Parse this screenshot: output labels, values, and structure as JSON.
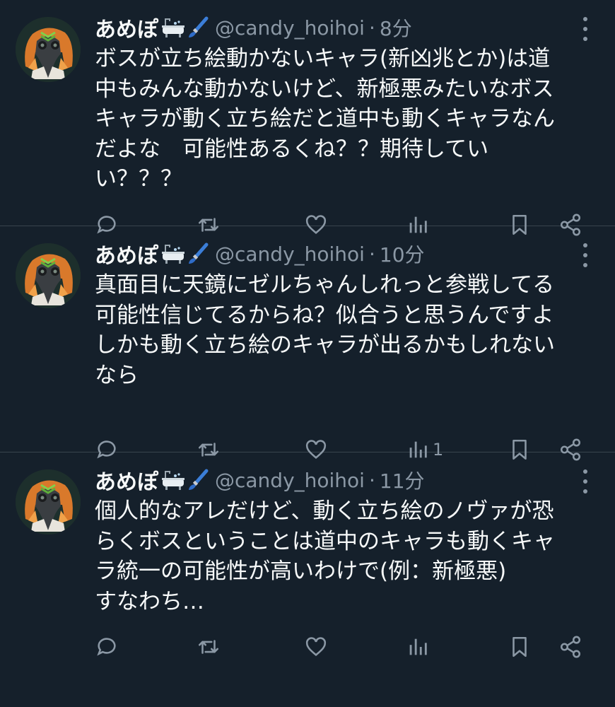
{
  "tweets": [
    {
      "name": "あめぽ",
      "handle": "@candy_hoihoi",
      "separator": "·",
      "time": "8分",
      "text": "ボスが立ち絵動かないキャラ(新凶兆とか)は道\n中もみんな動かないけど、新極悪みたいなボス\nキャラが動く立ち絵だと道中も動くキャラなん\nだよな　可能性あるくね？？期待してい\nい？？？",
      "views": ""
    },
    {
      "name": "あめぽ",
      "handle": "@candy_hoihoi",
      "separator": "·",
      "time": "10分",
      "text": "真面目に天鏡にゼルちゃんしれっと参戦してる\n可能性信じてるからね？似合うと思うんですよ\nしかも動く立ち絵のキャラが出るかもしれない\nなら",
      "views": "1"
    },
    {
      "name": "あめぽ",
      "handle": "@candy_hoihoi",
      "separator": "·",
      "time": "11分",
      "text": "個人的なアレだけど、動く立ち絵のノヴァが恐\nらくボスということは道中のキャラも動くキャ\nラ統一の可能性が高いわけで(例：新極悪)\nすなわち…",
      "views": ""
    }
  ],
  "icons": {
    "name_emojis": [
      "bathtub-emoji",
      "paintbrush-emoji"
    ],
    "more": "more-dots-icon",
    "reply": "reply-icon",
    "retweet": "retweet-icon",
    "like": "like-icon",
    "views": "views-icon",
    "bookmark": "bookmark-icon",
    "share": "share-icon"
  },
  "colors": {
    "background": "#15202b",
    "text": "#f7f9f9",
    "secondary": "#8b98a5",
    "divider": "#38444d"
  }
}
